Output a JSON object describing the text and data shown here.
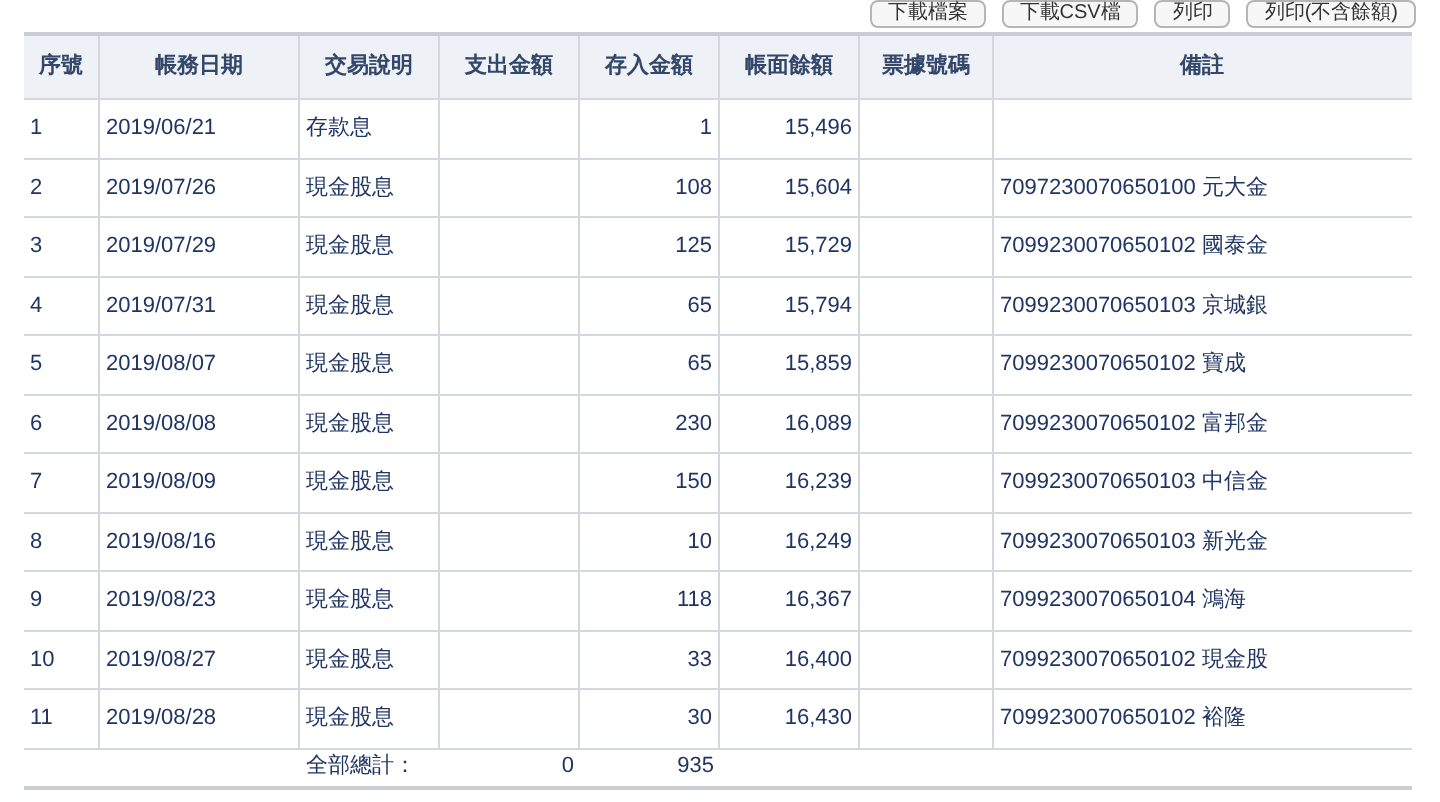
{
  "buttons": [
    "下載檔案",
    "下載CSV檔",
    "列印",
    "列印(不含餘額)"
  ],
  "table": {
    "columns": [
      "序號",
      "帳務日期",
      "交易說明",
      "支出金額",
      "存入金額",
      "帳面餘額",
      "票據號碼",
      "備註"
    ],
    "rows": [
      [
        "1",
        "2019/06/21",
        "存款息",
        "",
        "1",
        "15,496",
        "",
        ""
      ],
      [
        "2",
        "2019/07/26",
        "現金股息",
        "",
        "108",
        "15,604",
        "",
        "7097230070650100 元大金"
      ],
      [
        "3",
        "2019/07/29",
        "現金股息",
        "",
        "125",
        "15,729",
        "",
        "7099230070650102 國泰金"
      ],
      [
        "4",
        "2019/07/31",
        "現金股息",
        "",
        "65",
        "15,794",
        "",
        "7099230070650103 京城銀"
      ],
      [
        "5",
        "2019/08/07",
        "現金股息",
        "",
        "65",
        "15,859",
        "",
        "7099230070650102 寶成"
      ],
      [
        "6",
        "2019/08/08",
        "現金股息",
        "",
        "230",
        "16,089",
        "",
        "7099230070650102 富邦金"
      ],
      [
        "7",
        "2019/08/09",
        "現金股息",
        "",
        "150",
        "16,239",
        "",
        "7099230070650103 中信金"
      ],
      [
        "8",
        "2019/08/16",
        "現金股息",
        "",
        "10",
        "16,249",
        "",
        "7099230070650103 新光金"
      ],
      [
        "9",
        "2019/08/23",
        "現金股息",
        "",
        "118",
        "16,367",
        "",
        "7099230070650104 鴻海"
      ],
      [
        "10",
        "2019/08/27",
        "現金股息",
        "",
        "33",
        "16,400",
        "",
        "7099230070650102 現金股"
      ],
      [
        "11",
        "2019/08/28",
        "現金股息",
        "",
        "30",
        "16,430",
        "",
        "7099230070650102 裕隆"
      ]
    ],
    "total": {
      "label": "全部總計：",
      "withdrawal": "0",
      "deposit": "935"
    }
  }
}
